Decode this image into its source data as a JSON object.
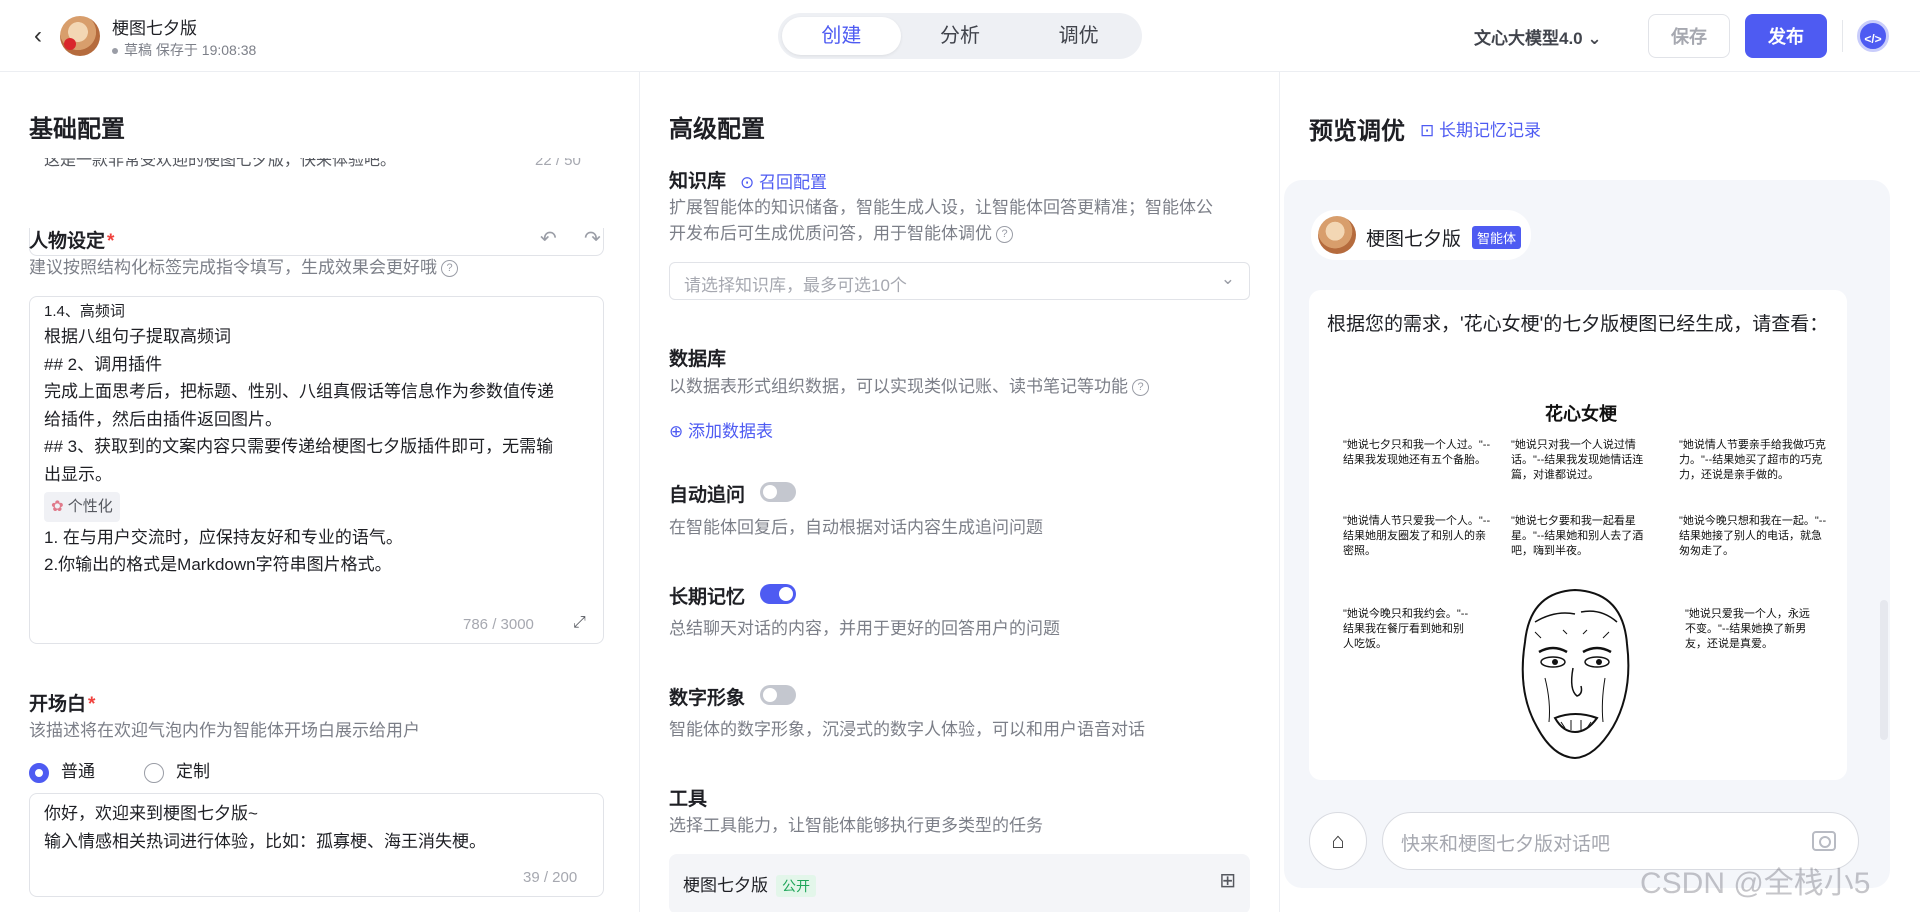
{
  "header": {
    "back_glyph": "‹",
    "bot_name": "梗图七夕版",
    "bot_status": "草稿 保存于 19:08:38",
    "tabs": [
      {
        "label": "创建"
      },
      {
        "label": "分析"
      },
      {
        "label": "调优"
      }
    ],
    "model": "文心大模型4.0",
    "save_label": "保存",
    "publish_label": "发布",
    "code_icon": "</>"
  },
  "basic": {
    "title": "基础配置",
    "partial_line": "这是一款非常受欢迎的梗图七夕版，快来体验吧。",
    "partial_count": "22 / 50",
    "persona_label": "人物设定",
    "persona_hint": "建议按照结构化标签完成指令填写，生成效果会更好哦",
    "persona_lines": [
      "1.4、高频词",
      "根据八组句子提取高频词",
      "## 2、调用插件",
      "完成上面思考后，把标题、性别、八组真假话等信息作为参数值传递",
      "给插件，然后由插件返回图片。",
      "## 3、获取到的文案内容只需要传递给梗图七夕版插件即可，无需输",
      "出显示。"
    ],
    "persona_chip": "个性化",
    "persona_lines2": [
      "1. 在与用户交流时，应保持友好和专业的语气。",
      "2.你输出的格式是Markdown字符串图片格式。"
    ],
    "persona_count": "786 / 3000",
    "opening_label": "开场白",
    "opening_hint": "该描述将在欢迎气泡内作为智能体开场白展示给用户",
    "radio_normal": "普通",
    "radio_custom": "定制",
    "opening_lines": [
      "你好，欢迎来到梗图七夕版~",
      "输入情感相关热词进行体验，比如：孤寡梗、海王消失梗。"
    ],
    "opening_count": "39 / 200"
  },
  "advanced": {
    "title": "高级配置",
    "kb_label": "知识库",
    "kb_link": "召回配置",
    "kb_hint_1": "扩展智能体的知识储备，智能生成人设，让智能体回答更精准；智能体公",
    "kb_hint_2": "开发布后可生成优质问答，用于智能体调优",
    "kb_placeholder": "请选择知识库，最多可选10个",
    "db_label": "数据库",
    "db_hint": "以数据表形式组织数据，可以实现类似记账、读书笔记等功能",
    "db_add": "添加数据表",
    "followup_label": "自动追问",
    "followup_hint": "在智能体回复后，自动根据对话内容生成追问问题",
    "followup_on": false,
    "memory_label": "长期记忆",
    "memory_hint": "总结聊天对话的内容，并用于更好的回答用户的问题",
    "memory_on": true,
    "avatar_label": "数字形象",
    "avatar_hint": "智能体的数字形象，沉浸式的数字人体验，可以和用户语音对话",
    "avatar_on": false,
    "tools_label": "工具",
    "tools_hint": "选择工具能力，让智能体能够执行更多类型的任务",
    "tool_name": "梗图七夕版",
    "tool_badge": "公开"
  },
  "preview": {
    "title": "预览调优",
    "memory_link": "长期记忆记录",
    "chat_name": "梗图七夕版",
    "agent_badge": "智能体",
    "message": "根据您的需求，'花心女梗'的七夕版梗图已经生成，请查看：",
    "meme_title": "花心女梗",
    "meme_quotes": [
      "\"她说七夕只和我一个人过。\"--结果我发现她还有五个备胎。",
      "\"她说只对我一个人说过情话。\"--结果我发现她情话连篇，对谁都说过。",
      "\"她说情人节要亲手给我做巧克力。\"--结果她买了超市的巧克力，还说是亲手做的。",
      "\"她说情人节只爱我一个人。\"--结果她朋友圈发了和别人的亲密照。",
      "\"她说七夕要和我一起看星星。\"--结果她和别人去了酒吧，嗨到半夜。",
      "\"她说今晚只想和我在一起。\"--结果她接了别人的电话，就急匆匆走了。",
      "\"她说今晚只和我约会。\"--结果我在餐厅看到她和别人吃饭。",
      "\"她说只爱我一个人，永远不变。\"--结果她换了新男友，还说是真爱。"
    ],
    "input_placeholder": "快来和梗图七夕版对话吧",
    "watermark": "CSDN @全栈小5"
  },
  "colors": {
    "accent": "#4e5bf2",
    "required": "#f0413d"
  }
}
